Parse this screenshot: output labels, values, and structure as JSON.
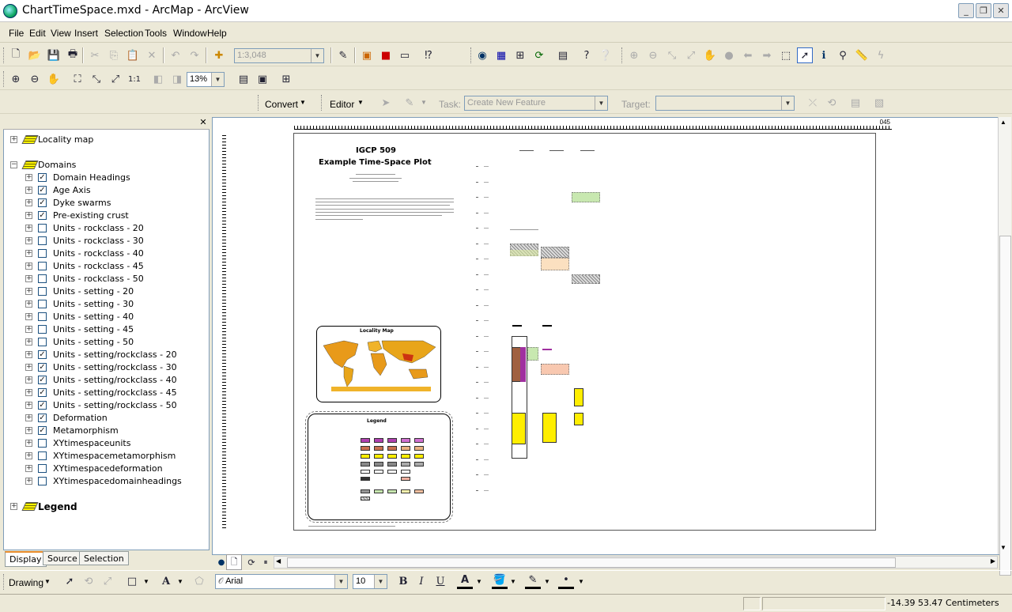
{
  "window": {
    "title": "ChartTimeSpace.mxd - ArcMap - ArcView"
  },
  "menu": [
    "File",
    "Edit",
    "View",
    "Insert",
    "Selection",
    "Tools",
    "Window",
    "Help"
  ],
  "toolbar": {
    "scale_value": "1:3,048",
    "zoom_value": "13%",
    "convert_label": "Convert",
    "editor_label": "Editor",
    "task_label": "Task:",
    "task_placeholder": "Create New Feature",
    "target_label": "Target:"
  },
  "toc": {
    "groups": [
      {
        "name": "Locality map"
      },
      {
        "name": "Domains"
      },
      {
        "name": "Legend"
      }
    ],
    "layers": [
      {
        "name": "Domain Headings",
        "checked": true
      },
      {
        "name": "Age Axis",
        "checked": true
      },
      {
        "name": "Dyke swarms",
        "checked": true
      },
      {
        "name": "Pre-existing crust",
        "checked": true
      },
      {
        "name": "Units - rockclass - 20",
        "checked": false
      },
      {
        "name": "Units - rockclass - 30",
        "checked": false
      },
      {
        "name": "Units - rockclass - 40",
        "checked": false
      },
      {
        "name": "Units - rockclass - 45",
        "checked": false
      },
      {
        "name": "Units - rockclass - 50",
        "checked": false
      },
      {
        "name": "Units - setting - 20",
        "checked": false
      },
      {
        "name": "Units - setting - 30",
        "checked": false
      },
      {
        "name": "Units - setting - 40",
        "checked": false
      },
      {
        "name": "Units - setting - 45",
        "checked": false
      },
      {
        "name": "Units - setting - 50",
        "checked": false
      },
      {
        "name": "Units - setting/rockclass - 20",
        "checked": true
      },
      {
        "name": "Units - setting/rockclass - 30",
        "checked": true
      },
      {
        "name": "Units - setting/rockclass - 40",
        "checked": true
      },
      {
        "name": "Units - setting/rockclass - 45",
        "checked": true
      },
      {
        "name": "Units - setting/rockclass - 50",
        "checked": true
      },
      {
        "name": "Deformation",
        "checked": true
      },
      {
        "name": "Metamorphism",
        "checked": true
      },
      {
        "name": "XYtimespaceunits",
        "checked": false
      },
      {
        "name": "XYtimespacemetamorphism",
        "checked": false
      },
      {
        "name": "XYtimespacedeformation",
        "checked": false
      },
      {
        "name": "XYtimespacedomainheadings",
        "checked": false
      }
    ],
    "tabs": [
      "Display",
      "Source",
      "Selection"
    ]
  },
  "layout": {
    "title_line1": "IGCP 509",
    "title_line2": "Example Time-Space Plot",
    "locality_map_title": "Locality Map",
    "legend_title": "Legend",
    "ruler_end": "045"
  },
  "drawing": {
    "drawing_label": "Drawing",
    "font_name": "Arial",
    "font_size": "10",
    "bold": "B",
    "italic": "I",
    "underline": "U",
    "text_tool": "A"
  },
  "status": {
    "coordinates": "-14.39  53.47 Centimeters"
  },
  "colors": {
    "accent": "#e68b2c",
    "selection_border": "#7f9db9"
  }
}
